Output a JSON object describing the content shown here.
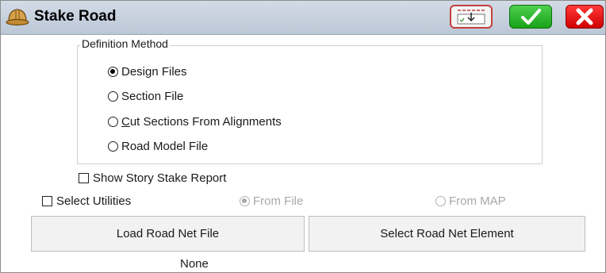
{
  "window": {
    "title": "Stake Road",
    "icons": {
      "app": "hard-hat-icon",
      "layout": "layout-settings-icon",
      "accept": "checkmark-icon",
      "close": "close-icon"
    },
    "colors": {
      "accept": "#19a219",
      "close": "#d00000",
      "titlebar": "#c6d0de"
    }
  },
  "definition_method": {
    "legend": "Definition Method",
    "options": [
      {
        "label": "Design Files",
        "selected": true
      },
      {
        "label": "Section File",
        "selected": false
      },
      {
        "label_prefix": "",
        "label_underline": "C",
        "label_rest": "ut Sections From Alignments",
        "selected": false
      },
      {
        "label": "Road Model File",
        "selected": false
      }
    ]
  },
  "show_story_stake_report": {
    "label": "Show Story Stake Report",
    "checked": false
  },
  "select_utilities": {
    "label": "Select Utilities",
    "checked": false,
    "from_file": {
      "label": "From File",
      "selected": true,
      "enabled": false
    },
    "from_map": {
      "label": "From MAP",
      "selected": false,
      "enabled": false
    }
  },
  "buttons": {
    "load_road_net_file": "Load Road Net File",
    "select_road_net_element": "Select Road Net Element"
  },
  "status": {
    "selected_file": "None"
  }
}
